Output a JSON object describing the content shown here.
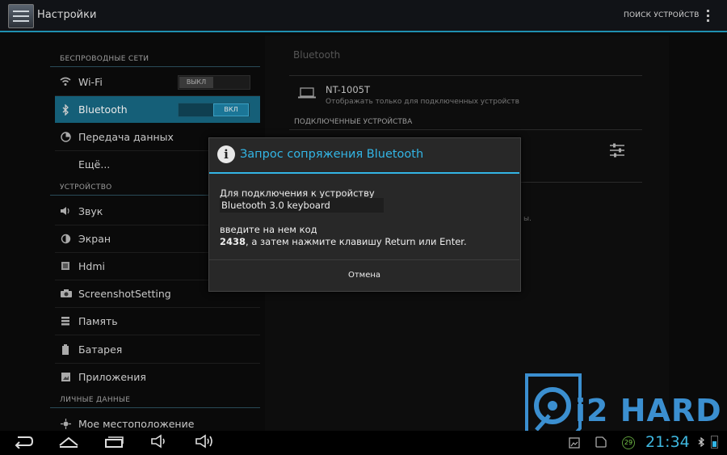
{
  "actionbar": {
    "title": "Настройки",
    "search_devices": "ПОИСК УСТРОЙСТВ"
  },
  "sidebar": {
    "section_wireless": "БЕСПРОВОДНЫЕ СЕТИ",
    "section_device": "УСТРОЙСТВО",
    "section_personal": "ЛИЧНЫЕ ДАННЫЕ",
    "items": [
      {
        "label": "Wi-Fi",
        "icon": "wifi-icon",
        "toggle": "ВЫКЛ"
      },
      {
        "label": "Bluetooth",
        "icon": "bluetooth-icon",
        "toggle": "ВКЛ"
      },
      {
        "label": "Передача данных",
        "icon": "data-usage-icon"
      },
      {
        "label": "Ещё..."
      },
      {
        "label": "Звук",
        "icon": "sound-icon"
      },
      {
        "label": "Экран",
        "icon": "display-icon"
      },
      {
        "label": "Hdmi",
        "icon": "hdmi-icon"
      },
      {
        "label": "ScreenshotSetting",
        "icon": "camera-icon"
      },
      {
        "label": "Память",
        "icon": "storage-icon"
      },
      {
        "label": "Батарея",
        "icon": "battery-icon"
      },
      {
        "label": "Приложения",
        "icon": "apps-icon"
      },
      {
        "label": "Мое местоположение",
        "icon": "location-icon"
      }
    ]
  },
  "bluetooth_pane": {
    "title": "Bluetooth",
    "device_name": "NT-1005T",
    "device_sub": "Отображать только для подключенных устройств",
    "paired_header": "ПОДКЛЮЧЕННЫЕ УСТРОЙСТВА",
    "partial_text": "ы."
  },
  "dialog": {
    "title": "Запрос сопряжения Bluetooth",
    "line1": "Для подключения к устройству",
    "device": "Bluetooth 3.0 keyboard",
    "line3": "введите на нем код",
    "code": "2438",
    "line4": ", а затем нажмите клавишу Return или Enter.",
    "cancel": "Отмена"
  },
  "statusbar": {
    "time": "21:34",
    "notification_count": "29"
  },
  "watermark": "i2 HARD",
  "colors": {
    "accent": "#33b5e5",
    "selected": "#155f78"
  }
}
